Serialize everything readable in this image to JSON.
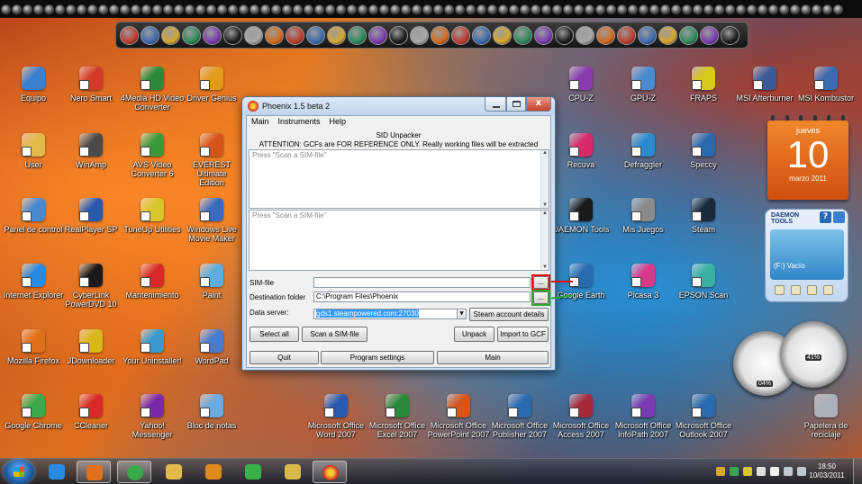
{
  "desktop": {
    "icons": [
      {
        "label": "Equipo",
        "color": "#3a7fd0"
      },
      {
        "label": "Nero Smart",
        "color": "#d33a2a"
      },
      {
        "label": "4Media HD Video\nConverter",
        "color": "#2a8a3a"
      },
      {
        "label": "Driver Genius",
        "color": "#e19a1a"
      },
      {
        "label": "User",
        "color": "#e2b94a"
      },
      {
        "label": "WinAmp",
        "color": "#4a4a4a"
      },
      {
        "label": "AVS Video\nConverter 6",
        "color": "#3a9a3a"
      },
      {
        "label": "EVEREST Ultimate\nEdition",
        "color": "#d4541a"
      },
      {
        "label": "Panel de control",
        "color": "#4a8ad0"
      },
      {
        "label": "RealPlayer SP",
        "color": "#2a5ab0"
      },
      {
        "label": "TuneUp Utilities",
        "color": "#d8c62a"
      },
      {
        "label": "Windows Live\nMovie Maker",
        "color": "#3a6ac0"
      },
      {
        "label": "Internet Explorer",
        "color": "#2a8ae0"
      },
      {
        "label": "CyberLink\nPowerDVD 10",
        "color": "#1a1a1a"
      },
      {
        "label": "Mantenimiento",
        "color": "#d82a2a"
      },
      {
        "label": "Paint",
        "color": "#5aaee0"
      },
      {
        "label": "Mozilla Firefox",
        "color": "#e0701a"
      },
      {
        "label": "JDownloader",
        "color": "#d8b81a"
      },
      {
        "label": "Your Uninstaller!",
        "color": "#3a9ad0"
      },
      {
        "label": "WordPad",
        "color": "#4a7ad0"
      },
      {
        "label": "Google Chrome",
        "color": "#3aa84a"
      },
      {
        "label": "CCleaner",
        "color": "#d82a2a"
      },
      {
        "label": "Yahoo!\nMessenger",
        "color": "#7a2aa8"
      },
      {
        "label": "Bloc de notas",
        "color": "#6aaae0"
      },
      {
        "label": "CPU-Z",
        "color": "#8a3ab0"
      },
      {
        "label": "GPU-Z",
        "color": "#4a8ad0"
      },
      {
        "label": "FRAPS",
        "color": "#d8c81a"
      },
      {
        "label": "MSI Afterburner",
        "color": "#3a5a9a"
      },
      {
        "label": "MSI Kombustor",
        "color": "#3a6ab0"
      },
      {
        "label": "Recuva",
        "color": "#d82a6a"
      },
      {
        "label": "Defraggler",
        "color": "#2a8ad0"
      },
      {
        "label": "Speccy",
        "color": "#2a6ab0"
      },
      {
        "label": "DAEMON Tools",
        "color": "#1a1a1a"
      },
      {
        "label": "Mis Juegos",
        "color": "#8a8a8a"
      },
      {
        "label": "Steam",
        "color": "#1a2a3a"
      },
      {
        "label": "Google Earth",
        "color": "#2a6ab0"
      },
      {
        "label": "Picasa 3",
        "color": "#d83a8a"
      },
      {
        "label": "EPSON Scan",
        "color": "#3ab0a0"
      },
      {
        "label": "Microsoft Office\nWord 2007",
        "color": "#2a5ab0"
      },
      {
        "label": "Microsoft Office\nExcel 2007",
        "color": "#2a8a3a"
      },
      {
        "label": "Microsoft Office\nPowerPoint 2007",
        "color": "#d8541a"
      },
      {
        "label": "Microsoft Office\nPublisher 2007",
        "color": "#2a6ab0"
      },
      {
        "label": "Microsoft Office\nAccess 2007",
        "color": "#a82a3a"
      },
      {
        "label": "Microsoft Office\nInfoPath 2007",
        "color": "#7a3ab0"
      },
      {
        "label": "Microsoft Office\nOutlook 2007",
        "color": "#2a6ab0"
      },
      {
        "label": "Papelera de\nreciclaje",
        "color": "#aab0b8"
      }
    ]
  },
  "window": {
    "title": "Phoenix 1.5 beta 2",
    "close_glyph": "x",
    "menu": [
      "Main",
      "Instruments",
      "Help"
    ],
    "heading": "SID Unpacker",
    "attention": "ATTENTION: GCFs are FOR REFERENCE ONLY. Really working files will be extracted instead!!",
    "log1_placeholder": "Press \"Scan a SIM-file\"",
    "log2_placeholder": "Press \"Scan a SIM-file\"",
    "sim_label": "SIM-file",
    "sim_value": "",
    "dest_label": "Destination folder",
    "dest_value": "C:\\Program Files\\Phoenix",
    "server_label": "Data server:",
    "server_value": "gds1.steampowered.com:27030",
    "browse": "...",
    "buttons": {
      "steam_account": "Steam account details",
      "select_all": "Select all",
      "scan": "Scan a SIM-file",
      "unpack": "Unpack",
      "import": "Import to GCF",
      "quit": "Quit",
      "settings": "Program settings",
      "main": "Main"
    }
  },
  "calendar": {
    "weekday": "jueves",
    "day": "10",
    "month": "marzo 2011"
  },
  "daemon": {
    "logo_line1": "DAEMON",
    "logo_line2": "TOOLS",
    "help": "?",
    "drive": "(F:) Vacío"
  },
  "gauges": {
    "cpu": "04%",
    "mem": "41%"
  },
  "taskbar": {
    "time": "18:50",
    "date": "10/03/2011"
  }
}
